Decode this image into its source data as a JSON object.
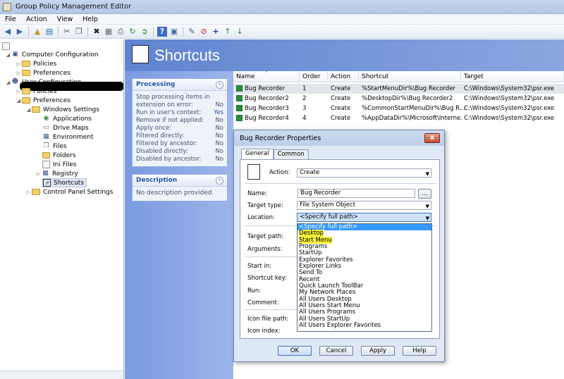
{
  "window": {
    "title": "Group Policy Management Editor"
  },
  "menu": [
    "File",
    "Action",
    "View",
    "Help"
  ],
  "toolbar_icons": [
    "back-icon",
    "forward-icon",
    "up-icon",
    "show-hide-tree-icon",
    "cut-icon",
    "copy-icon",
    "delete-icon",
    "properties-icon",
    "print-icon",
    "refresh-icon",
    "export-icon",
    "help-icon",
    "show-action-pane-icon",
    "new-item-icon",
    "stop-icon",
    "add-icon",
    "move-up-icon",
    "move-down-icon"
  ],
  "tree": {
    "root": "",
    "computer_config": "Computer Configuration",
    "cc_policies": "Policies",
    "cc_preferences": "Preferences",
    "user_config": "User Configuration",
    "uc_policies": "Policies",
    "uc_preferences": "Preferences",
    "windows_settings": "Windows Settings",
    "applications": "Applications",
    "drive_maps": "Drive Maps",
    "environment": "Environment",
    "files": "Files",
    "folders": "Folders",
    "ini_files": "Ini Files",
    "registry": "Registry",
    "shortcuts": "Shortcuts",
    "control_panel": "Control Panel Settings"
  },
  "banner": {
    "title": "Shortcuts"
  },
  "processing": {
    "header": "Processing",
    "rows": [
      {
        "label": "Stop processing items in extension on error:",
        "value": "No"
      },
      {
        "label": "Run in user's context:",
        "value": "Yes"
      },
      {
        "label": "Remove if not applied:",
        "value": "No"
      },
      {
        "label": "Apply once:",
        "value": "No"
      },
      {
        "label": "Filtered directly:",
        "value": "No"
      },
      {
        "label": "Filtered by ancestor:",
        "value": "No"
      },
      {
        "label": "Disabled directly:",
        "value": "No"
      },
      {
        "label": "Disabled by ancestor:",
        "value": "No"
      }
    ]
  },
  "description": {
    "header": "Description",
    "text": "No description provided."
  },
  "list": {
    "columns": [
      "Name",
      "Order",
      "Action",
      "Shortcut",
      "Target"
    ],
    "rows": [
      [
        "Bug Recorder",
        "1",
        "Create",
        "%StartMenuDir%\\Bug Recorder",
        "C:\\Windows\\System32\\psr.exe"
      ],
      [
        "Bug Recorder2",
        "2",
        "Create",
        "%DesktopDir%\\Bug Recorder2",
        "C:\\Windows\\System32\\psr.exe"
      ],
      [
        "Bug Recorder3",
        "3",
        "Create",
        "%CommonStartMenuDir%\\Bug R...",
        "C:\\Windows\\System32\\psr.exe"
      ],
      [
        "Bug Recorder4",
        "4",
        "Create",
        "%AppDataDir%\\Microsoft\\Interne...",
        "C:\\Windows\\System32\\psr.exe"
      ]
    ]
  },
  "dialog": {
    "title": "Bug Recorder Properties",
    "close": "x",
    "tabs": [
      "General",
      "Common"
    ],
    "action_label": "Action:",
    "action_value": "Create",
    "name_label": "Name:",
    "name_value": "Bug Recorder",
    "browse": "...",
    "target_type_label": "Target type:",
    "target_type_value": "File System Object",
    "location_label": "Location:",
    "location_value": "<Specify full path>",
    "target_path_label": "Target path:",
    "arguments_label": "Arguments:",
    "start_in_label": "Start in:",
    "shortcut_key_label": "Shortcut key:",
    "run_label": "Run:",
    "comment_label": "Comment:",
    "icon_file_path_label": "Icon file path:",
    "icon_index_label": "Icon index:",
    "location_options": [
      "<Specify full path>",
      "Desktop",
      "Start Menu",
      "Programs",
      "StartUp",
      "Explorer Favorites",
      "Explorer Links",
      "Send To",
      "Recent",
      "Quick Launch ToolBar",
      "My Network Places",
      "All Users Desktop",
      "All Users Start Menu",
      "All Users Programs",
      "All Users StartUp",
      "All Users Explorer Favorites"
    ],
    "selected_option": "<Specify full path>",
    "highlighted_options": [
      "Desktop",
      "Start Menu"
    ],
    "highlight_color": "#f6f03a",
    "select_color": "#3399ff",
    "buttons": {
      "ok": "OK",
      "cancel": "Cancel",
      "apply": "Apply",
      "help": "Help"
    }
  }
}
